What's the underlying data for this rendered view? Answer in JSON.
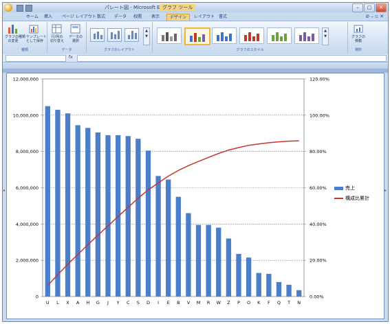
{
  "titlebar": {
    "title": "パレート図 - Microsoft Excel",
    "context_tool": "グラフ ツール"
  },
  "ribbon_tabs": [
    "ホーム",
    "挿入",
    "ページ レイアウト",
    "数式",
    "データ",
    "校閲",
    "表示",
    "デザイン",
    "レイアウト",
    "書式"
  ],
  "ribbon": {
    "type_group": {
      "label": "種類",
      "btn_change": "グラフの種類\nの変更",
      "btn_save": "テンプレート\nとして保存"
    },
    "data_group": {
      "label": "データ",
      "btn_switch": "行/列の\n切り替え",
      "btn_select": "データの\n選択"
    },
    "layout_group": {
      "label": "グラフのレイアウト"
    },
    "style_group": {
      "label": "グラフのスタイル"
    },
    "location_group": {
      "label": "場所",
      "btn_move": "グラフの\n移動"
    }
  },
  "formula_bar": {
    "fx_label": "fx"
  },
  "colors": {
    "bar": "#4a7ec8",
    "line": "#c6352c",
    "ribbon": "#d5e3f4",
    "design_tab": "#f6d47d"
  },
  "chart_data": {
    "type": "bar",
    "categories": [
      "U",
      "L",
      "X",
      "A",
      "H",
      "G",
      "J",
      "Y",
      "C",
      "S",
      "D",
      "I",
      "E",
      "B",
      "V",
      "M",
      "R",
      "W",
      "Z",
      "P",
      "O",
      "K",
      "F",
      "Q",
      "T",
      "N"
    ],
    "series": [
      {
        "name": "売上",
        "type": "bar",
        "axis": "left",
        "values": [
          10500000,
          10300000,
          10100000,
          9450000,
          9300000,
          9050000,
          8900000,
          8900000,
          8850000,
          8700000,
          8050000,
          6650000,
          6450000,
          5500000,
          4600000,
          3950000,
          3950000,
          3800000,
          3200000,
          2350000,
          2150000,
          1300000,
          1250000,
          800000,
          650000,
          350000
        ]
      },
      {
        "name": "構成比累計",
        "type": "line",
        "axis": "right",
        "values": [
          0.0605,
          0.1199,
          0.1781,
          0.2325,
          0.2861,
          0.3383,
          0.3895,
          0.4408,
          0.4918,
          0.5419,
          0.5883,
          0.6267,
          0.6638,
          0.6955,
          0.722,
          0.7448,
          0.7675,
          0.7894,
          0.8079,
          0.8214,
          0.8338,
          0.8413,
          0.8485,
          0.8531,
          0.8569,
          0.8589
        ]
      }
    ],
    "y_left": {
      "min": 0,
      "max": 12000000,
      "step": 2000000,
      "tick_labels": [
        "0",
        "2,000,000",
        "4,000,000",
        "6,000,000",
        "8,000,000",
        "10,000,000",
        "12,000,000"
      ]
    },
    "y_right": {
      "min": 0,
      "max": 1.2,
      "step": 0.2,
      "tick_labels": [
        "0.00%",
        "20.00%",
        "40.00%",
        "60.00%",
        "80.00%",
        "100.00%",
        "120.00%"
      ]
    },
    "grid": true,
    "legend": {
      "position": "right",
      "entries": [
        "売上",
        "構成比累計"
      ]
    }
  }
}
